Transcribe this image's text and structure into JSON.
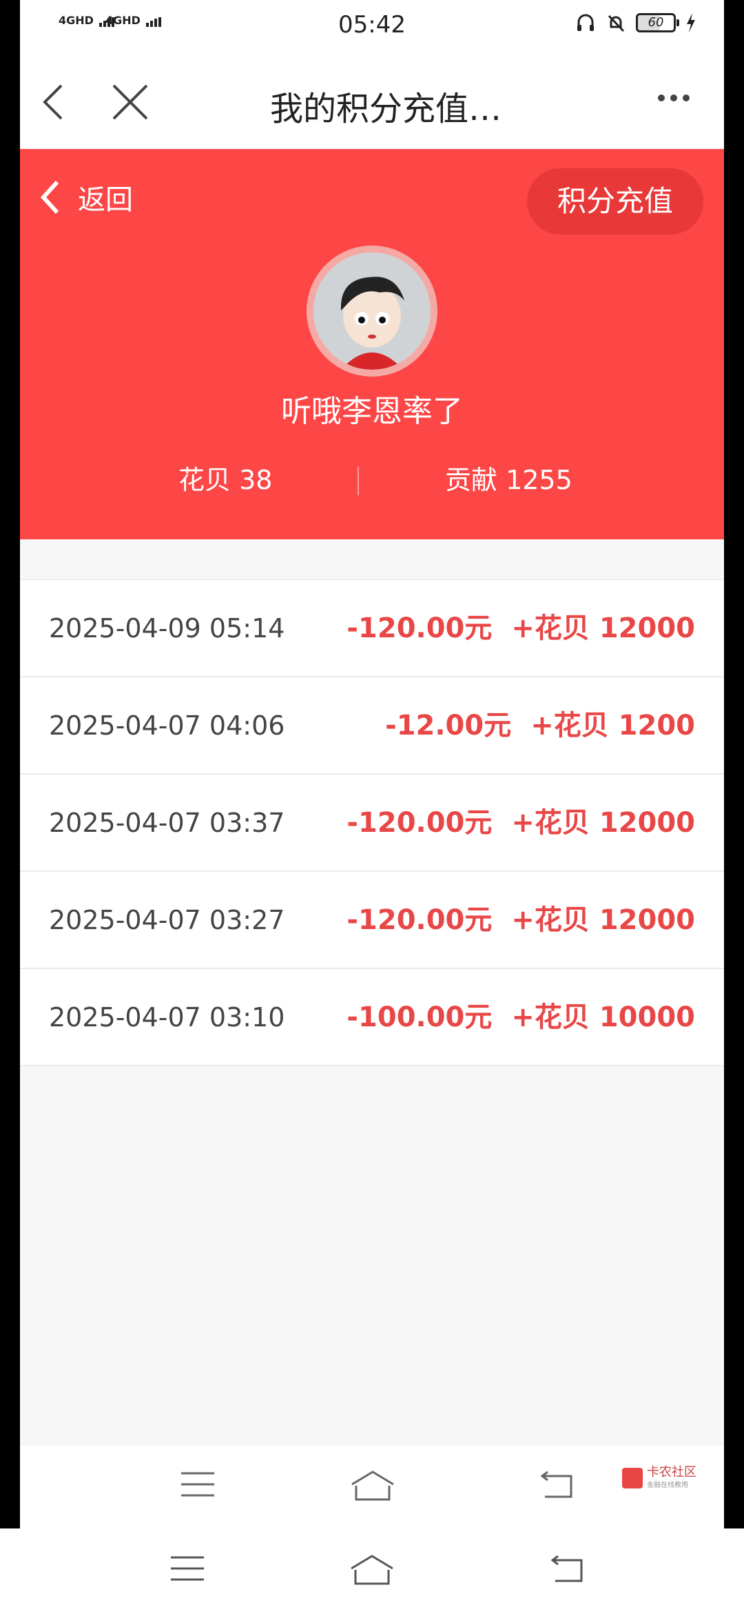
{
  "status_bar": {
    "network1": "4GHD",
    "network2": "4GHD",
    "time": "05:42",
    "battery": "60"
  },
  "nav": {
    "title": "我的积分充值…",
    "back_icon": "chevron-left-icon",
    "close_icon": "close-icon",
    "more_icon": "more-dots-icon"
  },
  "header": {
    "back_label": "返回",
    "recharge_label": "积分充值",
    "username": "听哦李恩率了",
    "huabei": "花贝 38",
    "gongxian": "贡献 1255",
    "bg_color": "#fd4646"
  },
  "records": [
    {
      "date": "2025-04-09 05:14",
      "amount": "-120.00元",
      "points": "+花贝 12000"
    },
    {
      "date": "2025-04-07 04:06",
      "amount": "-12.00元",
      "points": "+花贝 1200"
    },
    {
      "date": "2025-04-07 03:37",
      "amount": "-120.00元",
      "points": "+花贝 12000"
    },
    {
      "date": "2025-04-07 03:27",
      "amount": "-120.00元",
      "points": "+花贝 12000"
    },
    {
      "date": "2025-04-07 03:10",
      "amount": "-100.00元",
      "points": "+花贝 10000"
    }
  ],
  "watermark": {
    "title": "卡农社区",
    "subtitle": "金融在线教用"
  },
  "bottom_nav_icons": [
    "menu-icon",
    "home-icon",
    "back-icon"
  ],
  "system_nav_icons": [
    "menu-icon",
    "home-icon",
    "back-icon"
  ]
}
